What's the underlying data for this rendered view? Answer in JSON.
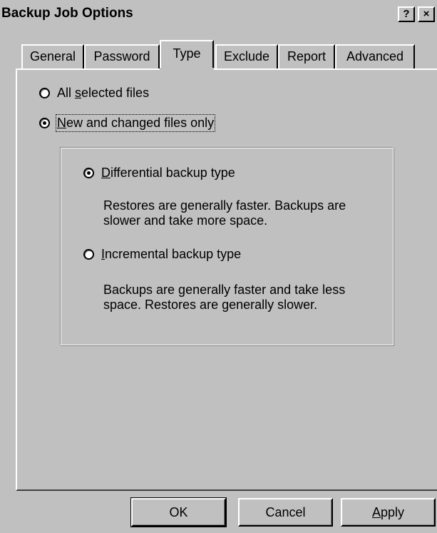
{
  "window": {
    "title": "Backup Job Options",
    "help_label": "?",
    "close_label": "×"
  },
  "tabs": [
    {
      "label": "General"
    },
    {
      "label": "Password"
    },
    {
      "label": "Type"
    },
    {
      "label": "Exclude"
    },
    {
      "label": "Report"
    },
    {
      "label": "Advanced"
    }
  ],
  "active_tab": "Type",
  "options": {
    "all_files": {
      "pre": "All ",
      "accel": "s",
      "post": "elected files",
      "checked": false
    },
    "new_changed": {
      "pre": "",
      "accel": "N",
      "post": "ew and changed files only",
      "checked": true
    }
  },
  "group": {
    "differential": {
      "accel": "D",
      "post": "ifferential backup type",
      "checked": true,
      "description_line1": "Restores are generally faster.  Backups are",
      "description_line2": "slower and take more space."
    },
    "incremental": {
      "accel": "I",
      "post": "ncremental backup type",
      "checked": false,
      "description_line1": "Backups are generally faster and take less",
      "description_line2": "space.  Restores are generally slower."
    }
  },
  "buttons": {
    "ok": "OK",
    "cancel": "Cancel",
    "apply_accel": "A",
    "apply_post": "pply"
  }
}
